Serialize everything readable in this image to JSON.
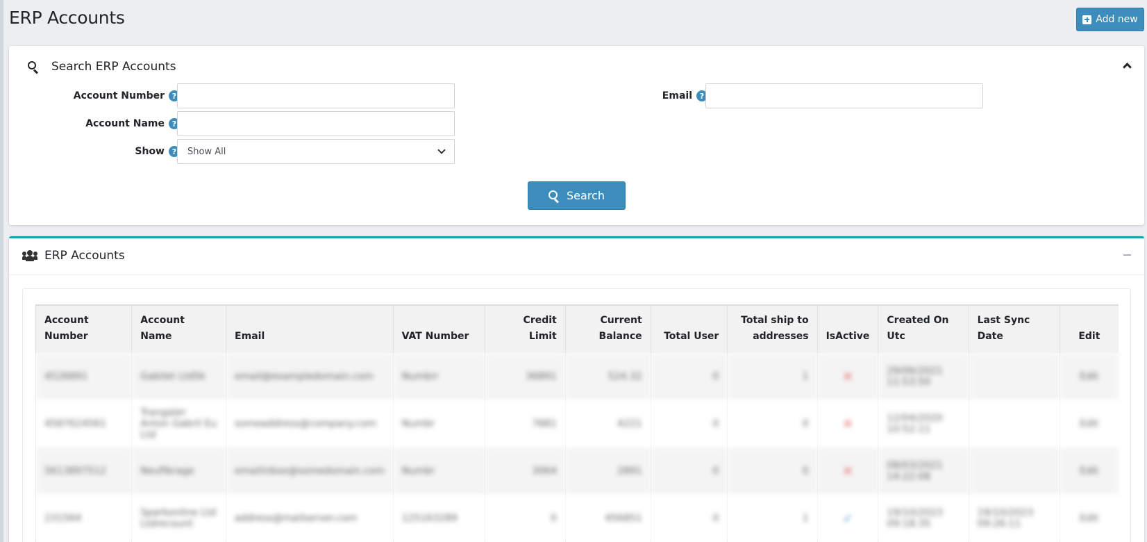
{
  "page": {
    "title": "ERP Accounts",
    "add_label": "Add new"
  },
  "search": {
    "title": "Search ERP Accounts",
    "fields": {
      "account_number": {
        "label": "Account Number",
        "value": ""
      },
      "account_name": {
        "label": "Account Name",
        "value": ""
      },
      "show": {
        "label": "Show",
        "value": "Show All"
      },
      "email": {
        "label": "Email",
        "value": ""
      }
    },
    "button_label": "Search"
  },
  "list": {
    "title": "ERP Accounts",
    "columns": [
      "Account Number",
      "Account Name",
      "Email",
      "VAT Number",
      "Credit Limit",
      "Current Balance",
      "Total User",
      "Total ship to addresses",
      "IsActive",
      "Created On Utc",
      "Last Sync Date",
      "Edit"
    ],
    "rows": [
      {
        "account_number": "4526891",
        "account_name": "Gabilet Ltd5k",
        "email": "email@exampledomain.com",
        "vat": "Numbrr",
        "credit_limit": "36891",
        "balance": "524.32",
        "total_user": "0",
        "ship_to": "1",
        "is_active": "✕",
        "created": "29/06/2021 11:53:50",
        "last_sync": "",
        "edit": "Edit"
      },
      {
        "account_number": "4587624561",
        "account_name": "Trangaler Anton Gabril Eu Ltd",
        "email": "someaddress@company.com",
        "vat": "Numbr",
        "credit_limit": "7881",
        "balance": "4221",
        "total_user": "0",
        "ship_to": "0",
        "is_active": "✕",
        "created": "12/04/2020 10:52:11",
        "last_sync": "",
        "edit": "Edit"
      },
      {
        "account_number": "5613897512",
        "account_name": "Neufibrage",
        "email": "emailinbox@somedomain.com",
        "vat": "Numbr",
        "credit_limit": "3064",
        "balance": "2891",
        "total_user": "0",
        "ship_to": "0",
        "is_active": "✕",
        "created": "08/03/2021 14:22:08",
        "last_sync": "",
        "edit": "Edit"
      },
      {
        "account_number": "231564",
        "account_name": "Sparkonline Ltd Ltdrecount",
        "email": "address@mailserver.com",
        "vat": "125163289",
        "credit_limit": "0",
        "balance": "456851",
        "total_user": "0",
        "ship_to": "1",
        "is_active": "✓",
        "created": "19/10/2023 09:18:35",
        "last_sync": "19/10/2023 09:26:11",
        "edit": "Edit"
      }
    ]
  },
  "colors": {
    "primary": "#3c8dbc",
    "accent_top": "#17a2b8",
    "inactive": "#e35d5d"
  }
}
